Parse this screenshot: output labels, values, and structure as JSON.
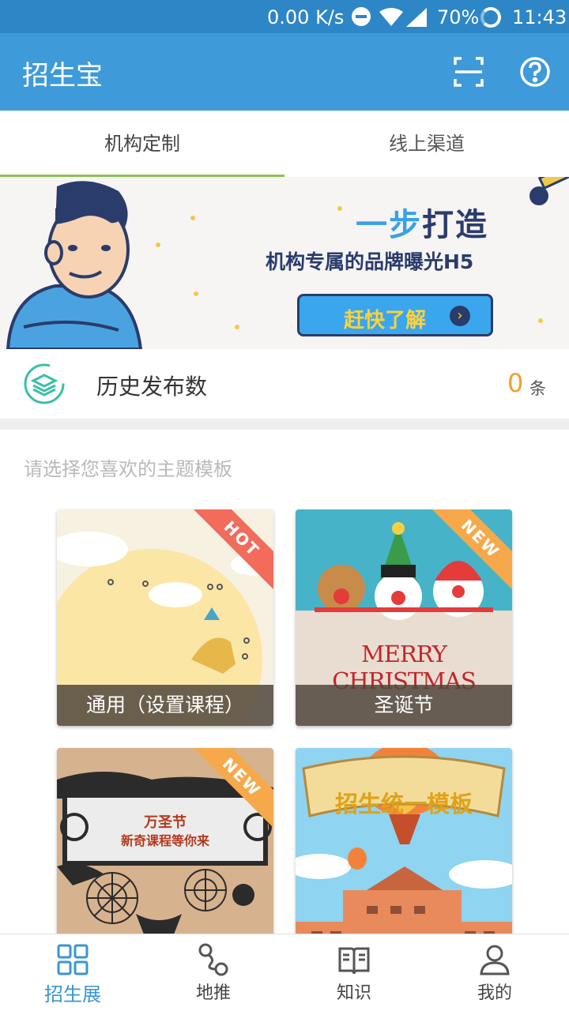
{
  "status_bar": {
    "speed": "0.00 K/s",
    "battery": "70%",
    "time": "11:43"
  },
  "app_bar": {
    "title": "招生宝"
  },
  "tabs": [
    {
      "label": "机构定制",
      "active": true
    },
    {
      "label": "线上渠道",
      "active": false
    }
  ],
  "banner": {
    "line1_a": "一步",
    "line1_b": "打造",
    "line2": "机构专属的品牌曝光H5",
    "button_label": "赶快了解",
    "button_arrow": "›"
  },
  "history": {
    "label": "历史发布数",
    "count": "0",
    "unit": "条"
  },
  "section_hint": "请选择您喜欢的主题模板",
  "templates": [
    {
      "caption": "通用（设置课程）",
      "badge": "HOT"
    },
    {
      "caption": "圣诞节",
      "badge": "NEW",
      "art_text": "MERRY CHRISTMAS"
    },
    {
      "caption": "",
      "badge": "NEW",
      "art_text_1": "万圣节",
      "art_text_2": "新奇课程等你来"
    },
    {
      "caption": "",
      "badge": "",
      "art_text": "招生统一模板"
    }
  ],
  "bottom_nav": [
    {
      "label": "招生展",
      "icon": "grid-icon",
      "active": true
    },
    {
      "label": "地推",
      "icon": "route-icon",
      "active": false
    },
    {
      "label": "知识",
      "icon": "book-icon",
      "active": false
    },
    {
      "label": "我的",
      "icon": "person-icon",
      "active": false
    }
  ],
  "colors": {
    "status_bar": "#2d86c6",
    "app_bar": "#3f9ad9",
    "tab_indicator": "#8cc152",
    "count": "#f0a030",
    "nav_active": "#3a94d6"
  }
}
